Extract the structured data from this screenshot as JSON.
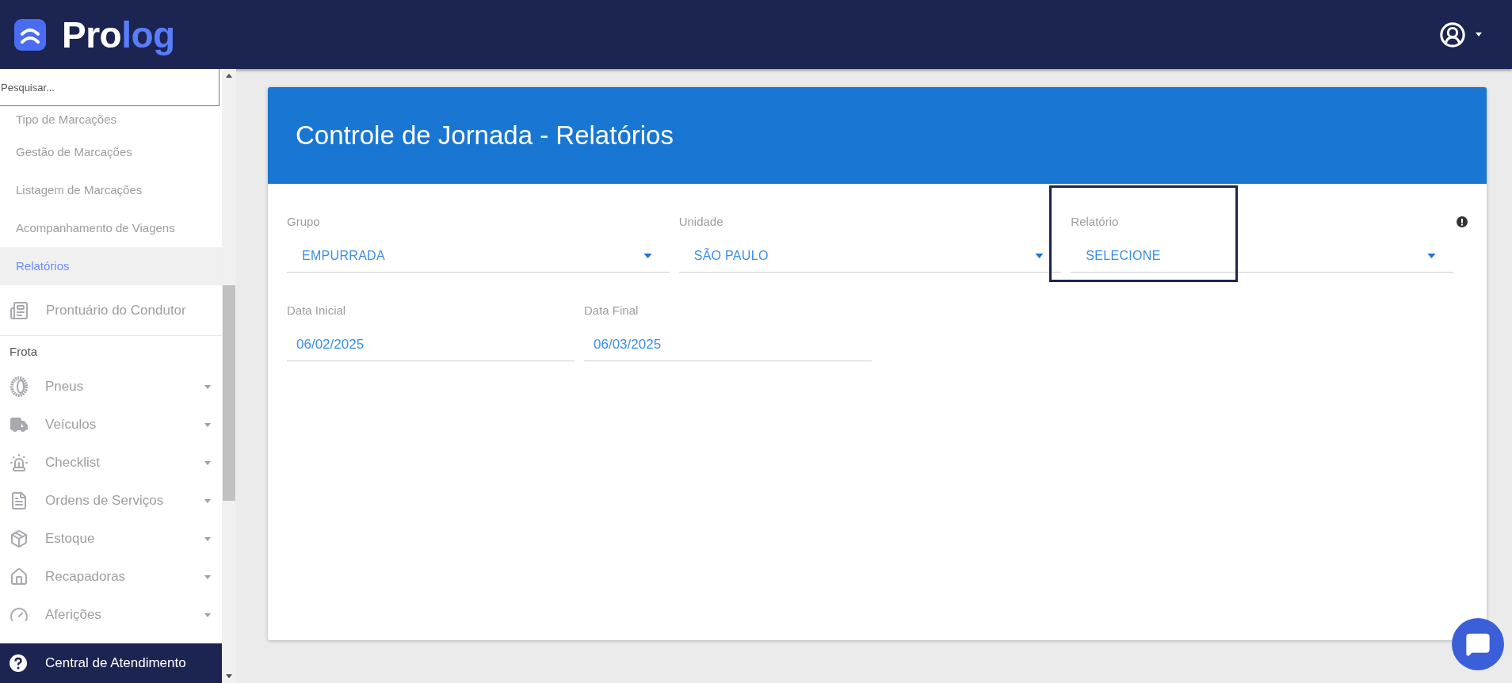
{
  "header": {
    "logo": [
      "Pro",
      "log"
    ]
  },
  "sidebar": {
    "search": {
      "placeholder": "Pesquisar..."
    },
    "items": [
      {
        "kind": "subitem",
        "label": "Tipo de Marcações",
        "selected": false
      },
      {
        "kind": "subitem",
        "label": "Gestão de Marcações",
        "selected": false
      },
      {
        "kind": "subitem",
        "label": "Listagem de Marcações",
        "selected": false
      },
      {
        "kind": "subitem",
        "label": "Acompanhamento de Viagens",
        "selected": false
      },
      {
        "kind": "subitem",
        "label": "Relatórios",
        "selected": true
      },
      {
        "kind": "link",
        "label": "Prontuário do Condutor",
        "selected": false
      },
      {
        "kind": "section",
        "label": "Frota"
      },
      {
        "kind": "group",
        "label": "Pneus",
        "selected": false
      },
      {
        "kind": "group",
        "label": "Veículos",
        "selected": false
      },
      {
        "kind": "group",
        "label": "Checklist",
        "selected": false
      },
      {
        "kind": "group",
        "label": "Ordens de Serviços",
        "selected": false
      },
      {
        "kind": "group",
        "label": "Estoque",
        "selected": false
      },
      {
        "kind": "group",
        "label": "Recapadoras",
        "selected": false
      },
      {
        "kind": "group",
        "label": "Aferições",
        "selected": false
      }
    ],
    "footer": {
      "label": "Central de Atendimento"
    }
  },
  "card": {
    "title": "Controle de Jornada - Relatórios",
    "rows": [
      [
        {
          "kind": "select",
          "label": "Grupo",
          "value": "EMPURRADA",
          "highlighted": false,
          "alert": false
        },
        {
          "kind": "select",
          "label": "Unidade",
          "value": "SÃO PAULO",
          "highlighted": false,
          "alert": false
        },
        {
          "kind": "select",
          "label": "Relatório",
          "value": "SELECIONE",
          "highlighted": true,
          "alert": true
        }
      ],
      [
        {
          "kind": "date",
          "label": "Data Inicial",
          "value": "06/02/2025",
          "highlighted": false,
          "alert": false
        },
        {
          "kind": "date",
          "label": "Data Final",
          "value": "06/03/2025",
          "highlighted": false,
          "alert": false
        }
      ]
    ]
  }
}
